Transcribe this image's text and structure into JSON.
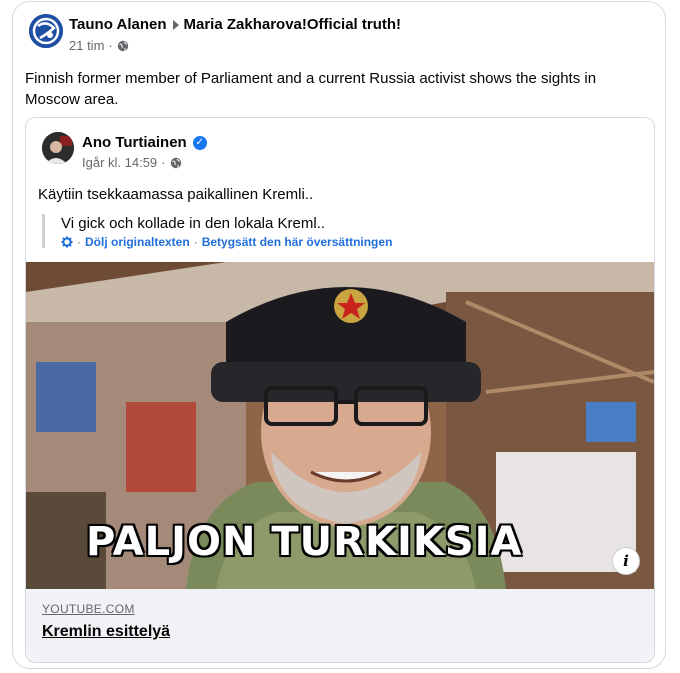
{
  "post": {
    "author": "Tauno Alanen",
    "group": "Maria Zakharova!Official truth!",
    "time": "21 tim",
    "text": "Finnish former member of Parliament and a current Russia activist shows the sights in Moscow area."
  },
  "shared": {
    "author": "Ano Turtiainen",
    "time": "Igår kl. 14:59",
    "text": "Käytiin tsekkaamassa paikallinen Kremli..",
    "translation": {
      "text": "Vi gick och kollade in den lokala Kreml..",
      "hide_link": "Dölj originaltexten",
      "rate_link": "Betygsätt den här översättningen"
    },
    "video": {
      "caption": "PALJON TURKIKSIA",
      "info_icon": "info-icon"
    },
    "link": {
      "domain": "YOUTUBE.COM",
      "title": "Kremlin esittelyä"
    }
  },
  "colors": {
    "link_blue": "#216fdb",
    "verified_blue": "#1877f2",
    "meta_gray": "#65676b",
    "link_box_bg": "#f0f2f5"
  }
}
